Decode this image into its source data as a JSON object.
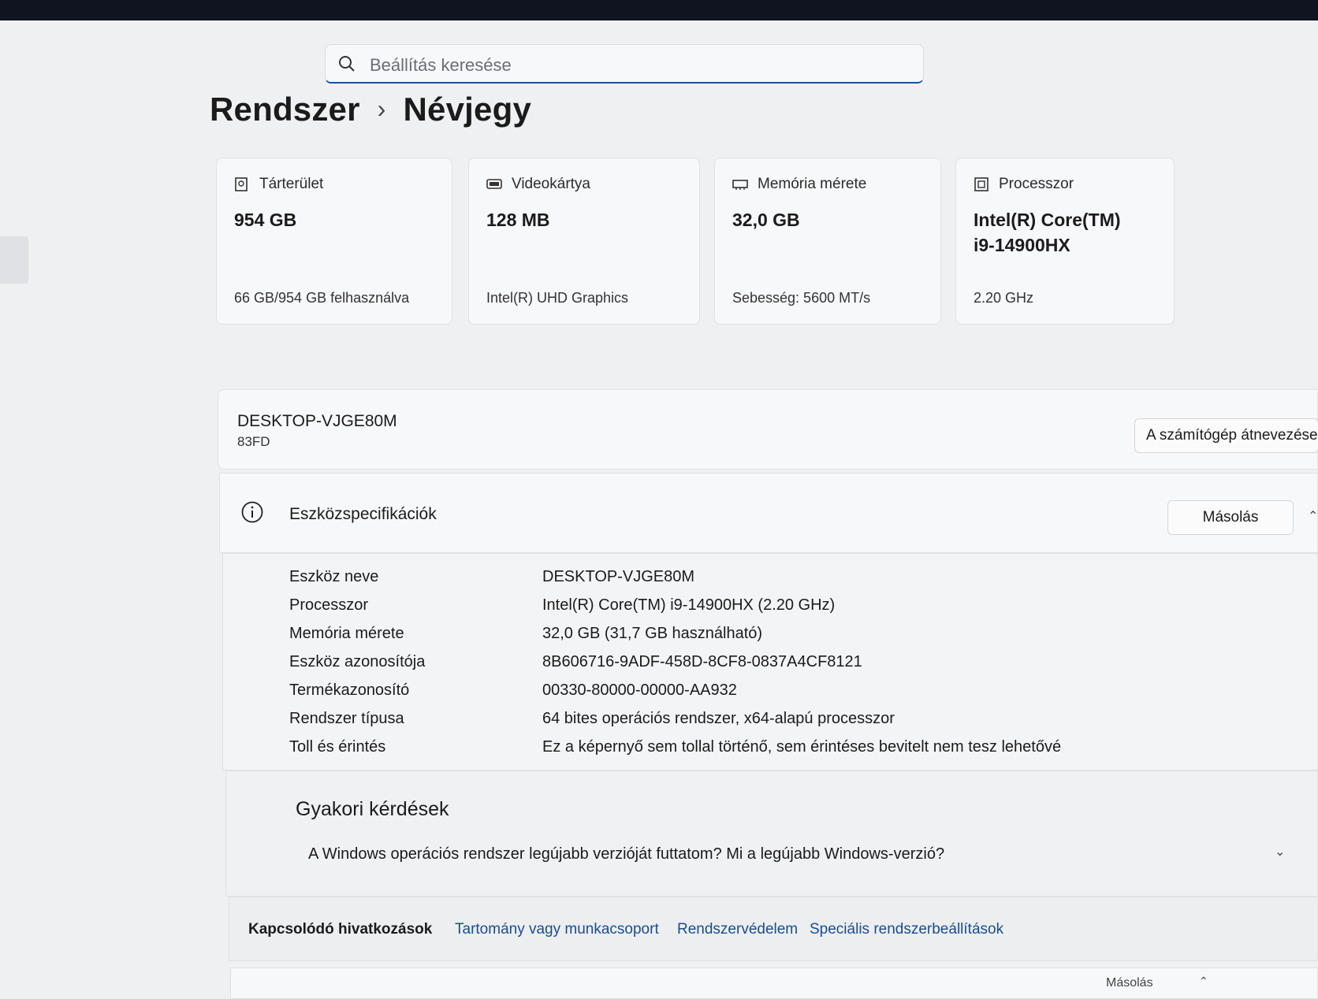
{
  "search": {
    "placeholder": "Beállítás keresése",
    "icon": "search-icon"
  },
  "breadcrumb": {
    "parent": "Rendszer",
    "separator": "›",
    "current": "Névjegy"
  },
  "cards": [
    {
      "icon": "storage-icon",
      "label": "Tárterület",
      "value": "954 GB",
      "sub": "66 GB/954 GB felhasználva"
    },
    {
      "icon": "gpu-icon",
      "label": "Videokártya",
      "value": "128 MB",
      "sub": "Intel(R) UHD Graphics"
    },
    {
      "icon": "memory-icon",
      "label": "Memória mérete",
      "value": "32,0 GB",
      "sub": "Sebesség: 5600 MT/s"
    },
    {
      "icon": "cpu-icon",
      "label": "Processzor",
      "value_line1": "Intel(R) Core(TM)",
      "value_line2": "i9-14900HX",
      "sub": "2.20 GHz"
    }
  ],
  "device": {
    "name": "DESKTOP-VJGE80M",
    "model": "83FD",
    "rename_label": "A számítógép átnevezése"
  },
  "specs": {
    "title": "Eszközspecifikációk",
    "copy_label": "Másolás",
    "rows": [
      {
        "key": "Eszköz neve",
        "value": "DESKTOP-VJGE80M"
      },
      {
        "key": "Processzor",
        "value": "Intel(R) Core(TM) i9-14900HX (2.20 GHz)"
      },
      {
        "key": "Memória mérete",
        "value": "32,0 GB (31,7 GB használható)"
      },
      {
        "key": "Eszköz azonosítója",
        "value": "8B606716-9ADF-458D-8CF8-0837A4CF8121"
      },
      {
        "key": "Termékazonosító",
        "value": "00330-80000-00000-AA932"
      },
      {
        "key": "Rendszer típusa",
        "value": "64 bites operációs rendszer, x64-alapú processzor"
      },
      {
        "key": "Toll és érintés",
        "value": "Ez a képernyő sem tollal történő, sem érintéses bevitelt nem tesz lehetővé"
      }
    ]
  },
  "faq": {
    "title": "Gyakori kérdések",
    "question": "A Windows operációs rendszer legújabb verzióját futtatom? Mi a legújabb Windows-verzió?"
  },
  "related": {
    "label": "Kapcsolódó hivatkozások",
    "links": [
      "Tartomány vagy munkacsoport",
      "Rendszervédelem",
      "Speciális rendszerbeállítások"
    ]
  },
  "bottom": {
    "copy_label": "Másolás"
  }
}
